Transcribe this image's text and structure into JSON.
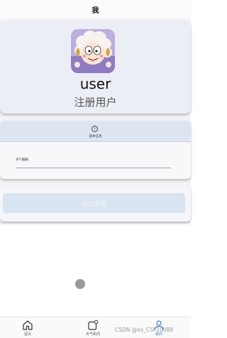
{
  "header": {
    "title": "我"
  },
  "profile": {
    "avatar_icon": "cartoon-sheep-avatar",
    "username": "user",
    "subtitle": "注册用户"
  },
  "basic_info": {
    "icon": "info-icon",
    "title": "基本信息",
    "field_label": "天气播报"
  },
  "logout": {
    "label": "退出登录"
  },
  "tabbar": {
    "tabs": [
      {
        "label": "首页",
        "icon": "home-icon",
        "active": false
      },
      {
        "label": "天气新闻",
        "icon": "news-icon",
        "active": false
      },
      {
        "label": "我的",
        "icon": "user-icon",
        "active": true
      }
    ]
  },
  "watermark": "CSDN @xx_CSF10088",
  "colors": {
    "accent": "#3b82d6",
    "logout_button": "#d9e4f1",
    "info_header": "#dde6f0"
  }
}
